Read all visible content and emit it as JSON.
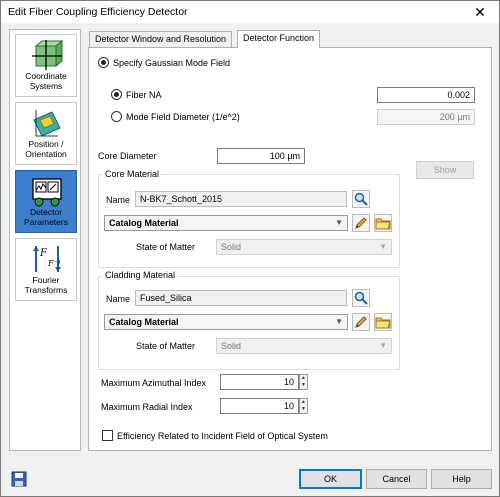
{
  "window": {
    "title": "Edit Fiber Coupling Efficiency Detector",
    "close_glyph": "✕"
  },
  "sidebar": {
    "items": [
      {
        "label_line1": "Coordinate",
        "label_line2": "Systems"
      },
      {
        "label_line1": "Position /",
        "label_line2": "Orientation"
      },
      {
        "label_line1": "Detector",
        "label_line2": "Parameters"
      },
      {
        "label_line1": "Fourier",
        "label_line2": "Transforms"
      }
    ],
    "selected_index": 2
  },
  "tabs": [
    {
      "label": "Detector Window and Resolution"
    },
    {
      "label": "Detector Function"
    }
  ],
  "function_panel": {
    "gaussian_mode_label": "Specify Gaussian Mode Field",
    "fiber_na_label": "Fiber NA",
    "fiber_na_value": "0.002",
    "mfd_label": "Mode Field Diameter (1/e^2)",
    "mfd_value": "200 µm",
    "core_diameter_label": "Core Diameter",
    "core_diameter_value": "100 µm",
    "show_button": "Show"
  },
  "core_material": {
    "title": "Core Material",
    "name_label": "Name",
    "name_value": "N-BK7_Schott_2015",
    "catalog_value": "Catalog Material",
    "state_label": "State of Matter",
    "state_value": "Solid"
  },
  "cladding_material": {
    "title": "Cladding Material",
    "name_label": "Name",
    "name_value": "Fused_Silica",
    "catalog_value": "Catalog Material",
    "state_label": "State of Matter",
    "state_value": "Solid"
  },
  "indices": {
    "azimuthal_label": "Maximum Azimuthal Index",
    "azimuthal_value": "10",
    "radial_label": "Maximum Radial Index",
    "radial_value": "10"
  },
  "efficiency_checkbox_label": "Efficiency Related to Incident Field of Optical System",
  "footer": {
    "ok": "OK",
    "cancel": "Cancel",
    "help": "Help"
  },
  "colors": {
    "selection": "#3c7fcf",
    "accent_border": "#0078d7"
  }
}
